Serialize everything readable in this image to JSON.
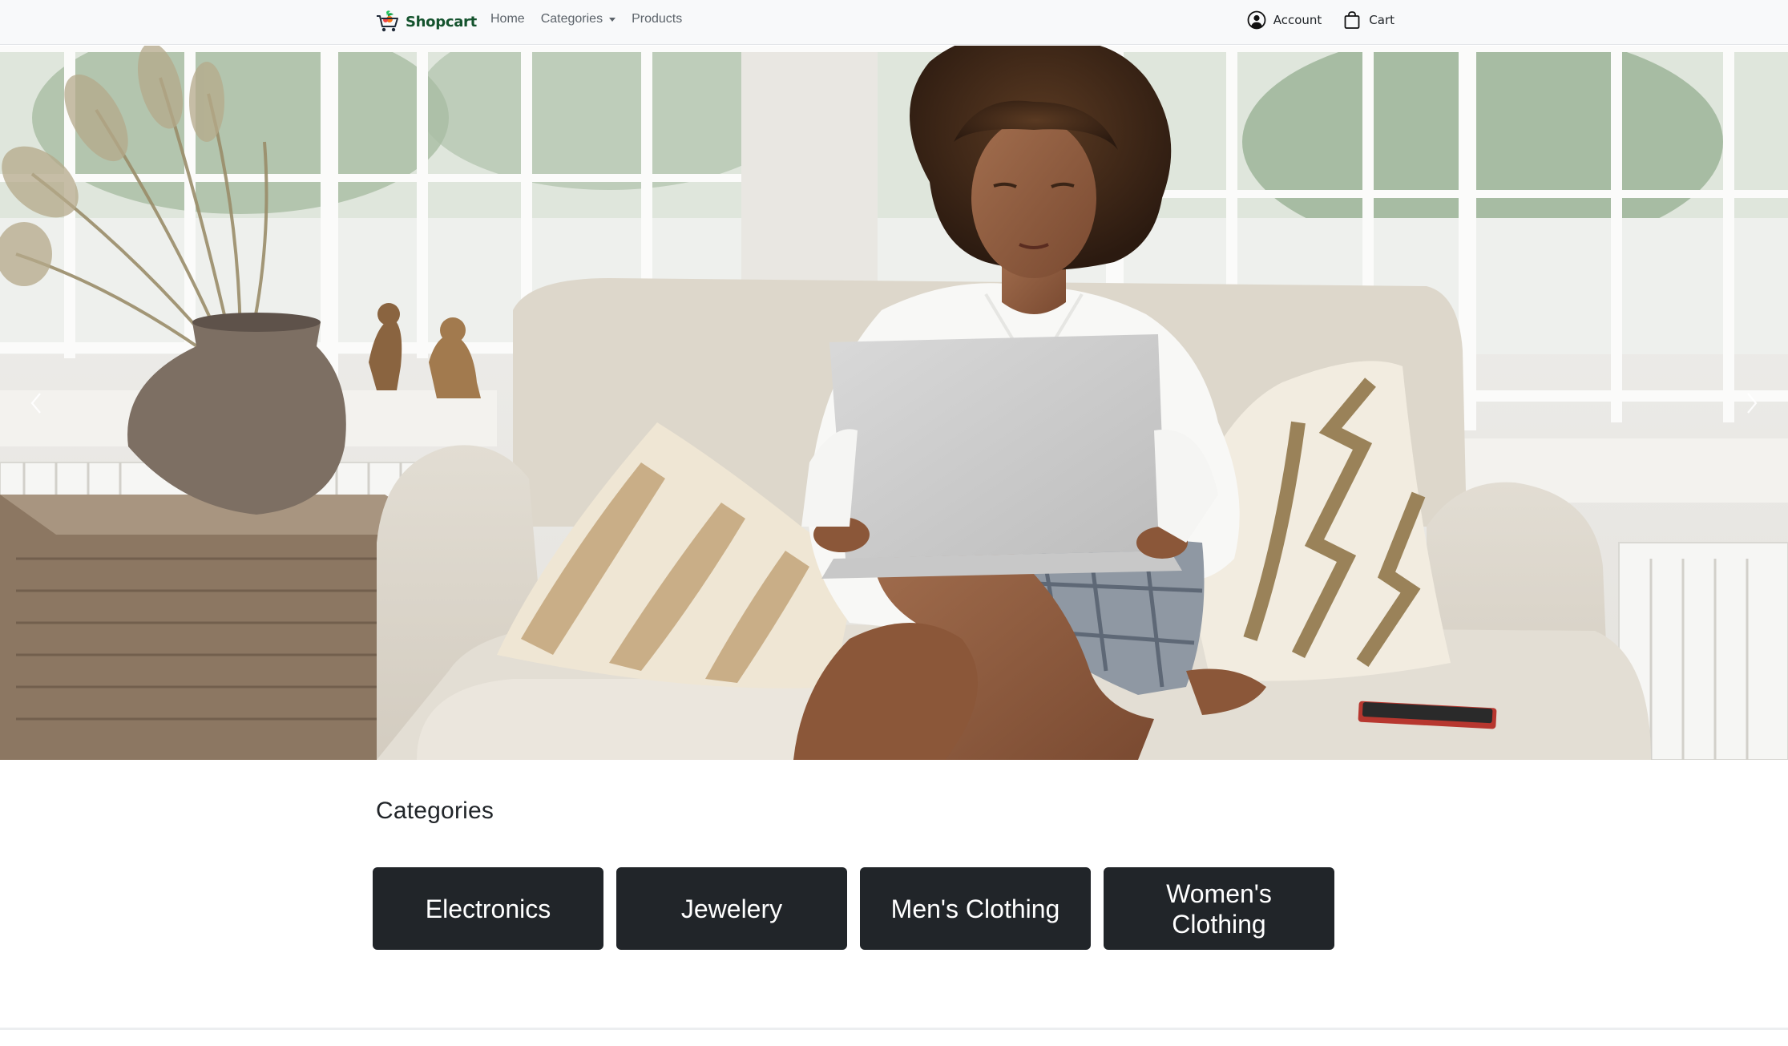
{
  "navbar": {
    "brand": "Shopcart",
    "links": [
      {
        "label": "Home"
      },
      {
        "label": "Categories"
      },
      {
        "label": "Products"
      }
    ],
    "account_label": "Account",
    "cart_label": "Cart"
  },
  "hero": {
    "image": "woman-on-sofa-with-laptop",
    "prev_icon": "chevron-left-icon",
    "next_icon": "chevron-right-icon"
  },
  "categories": {
    "title": "Categories",
    "items": [
      {
        "label": "Electronics"
      },
      {
        "label": "Jewelery"
      },
      {
        "label": "Men's Clothing"
      },
      {
        "label": "Women's Clothing"
      }
    ]
  },
  "colors": {
    "navbar_bg": "#f8f9fa",
    "brand_text": "#14532d",
    "card_bg": "#212529",
    "card_text": "#ffffff"
  }
}
